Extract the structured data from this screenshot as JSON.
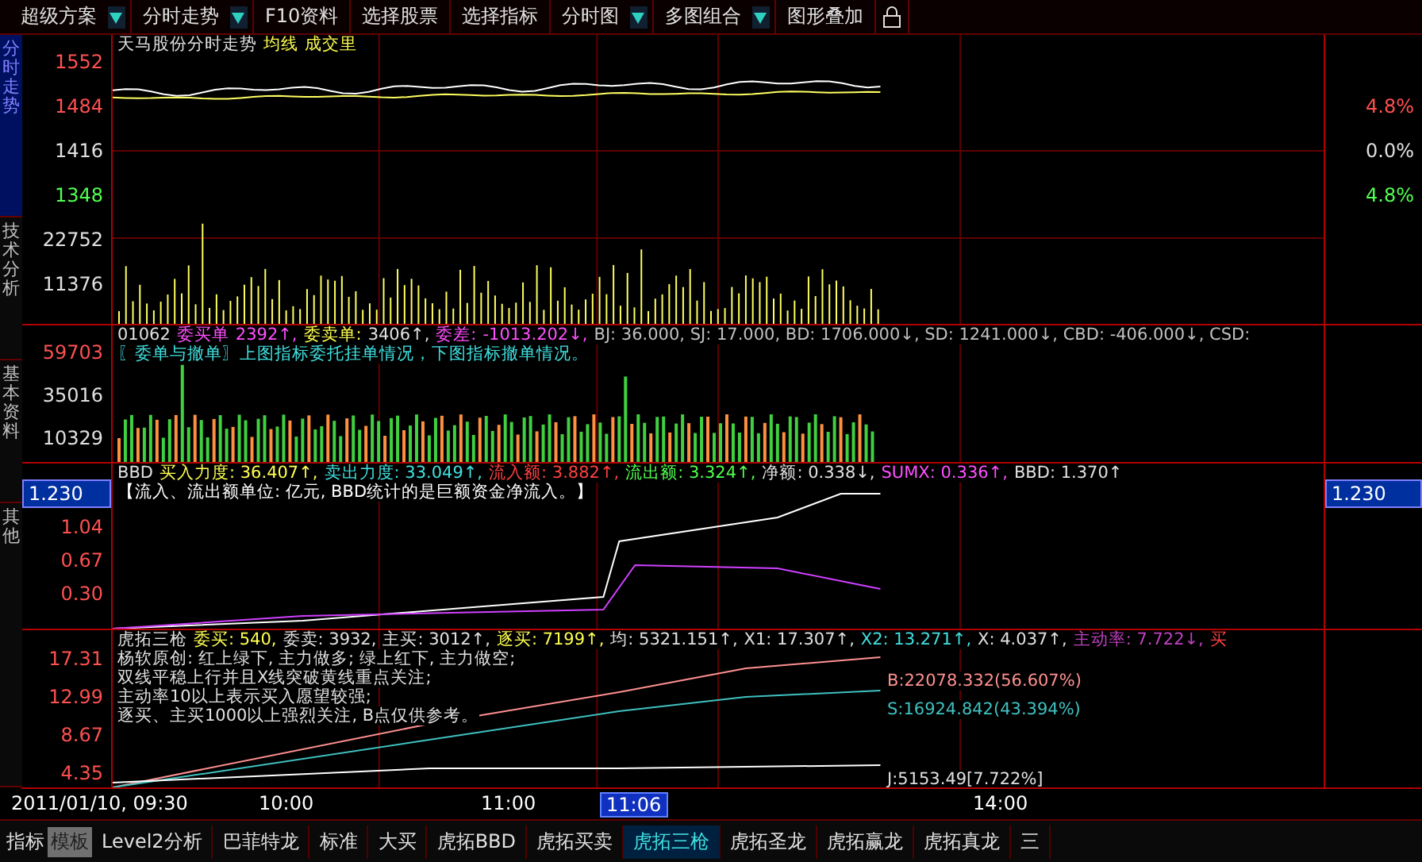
{
  "toolbar": [
    {
      "label": "超级方案",
      "dropdown": true
    },
    {
      "label": "分时走势",
      "dropdown": true
    },
    {
      "label": "F10资料",
      "dropdown": false
    },
    {
      "label": "选择股票",
      "dropdown": false
    },
    {
      "label": "选择指标",
      "dropdown": false
    },
    {
      "label": "分时图",
      "dropdown": true
    },
    {
      "label": "多图组合",
      "dropdown": true
    },
    {
      "label": "图形叠加",
      "dropdown": false
    }
  ],
  "side_tabs": [
    {
      "label": "分时走势",
      "selected": true
    },
    {
      "label": "技术分析",
      "selected": false
    },
    {
      "label": "基本资料",
      "selected": false
    },
    {
      "label": "其他",
      "selected": false
    }
  ],
  "panels": [
    {
      "kind": "price",
      "header": [
        [
          {
            "text": "天马股份分时走势",
            "color": "#e0e0e0"
          },
          {
            "text": "均线",
            "color": "#ffff50"
          },
          {
            "text": "成交里",
            "color": "#ffff50"
          }
        ]
      ],
      "left_axis": [
        {
          "text": "1552",
          "color": "#ff5050"
        },
        {
          "text": "1484",
          "color": "#ff5050"
        },
        {
          "text": "1416",
          "color": "#e0e0e0"
        },
        {
          "text": "1348",
          "color": "#50ff50"
        },
        {
          "text": "22752",
          "color": "#e0e0e0"
        },
        {
          "text": "11376",
          "color": "#e0e0e0"
        }
      ],
      "right_axis": [
        {
          "text": "4.8%",
          "color": "#ff5050"
        },
        {
          "text": "0.0%",
          "color": "#e0e0e0"
        },
        {
          "text": "4.8%",
          "color": "#50ff50"
        }
      ]
    },
    {
      "kind": "orders",
      "header": [
        [
          {
            "text": "01062",
            "color": "#e0e0e0"
          },
          {
            "text": "委买单",
            "color": "#ff50ff"
          },
          {
            "text": "2392↑,",
            "color": "#ff50ff"
          },
          {
            "text": "委卖单:",
            "color": "#ffff50"
          },
          {
            "text": "3406↑,",
            "color": "#e0e0e0"
          },
          {
            "text": "委差:",
            "color": "#ff50ff"
          },
          {
            "text": "-1013.202↓,",
            "color": "#ff50ff"
          },
          {
            "text": "BJ: 36.000, SJ: 17.000, BD: 1706.000↓, SD: 1241.000↓, CBD: -406.000↓, CSD:",
            "color": "#c0c0c0"
          }
        ],
        [
          {
            "text": "〖委单与撤单〗上图指标委托挂单情况，下图指标撤单情况。",
            "color": "#40e0e0"
          }
        ]
      ],
      "left_axis": [
        {
          "text": "59703",
          "color": "#ff5050"
        },
        {
          "text": "35016",
          "color": "#e0e0e0"
        },
        {
          "text": "10329",
          "color": "#e0e0e0"
        }
      ]
    },
    {
      "kind": "flow",
      "header": [
        [
          {
            "text": "BBD",
            "color": "#e0e0e0"
          },
          {
            "text": "买入力度: 36.407↑,",
            "color": "#ffff50"
          },
          {
            "text": "卖出力度: 33.049↑,",
            "color": "#40e0e0"
          },
          {
            "text": "流入额: 3.882↑,",
            "color": "#ff4040"
          },
          {
            "text": "流出额: 3.324↑,",
            "color": "#50ff50"
          },
          {
            "text": "净额: 0.338↓,",
            "color": "#e0e0e0"
          },
          {
            "text": "SUMX: 0.336↑,",
            "color": "#ff50ff"
          },
          {
            "text": "BBD: 1.370↑",
            "color": "#e0e0e0"
          }
        ],
        [
          {
            "text": "【流入、流出额单位: 亿元, BBD统计的是巨额资金净流入。】",
            "color": "#ffffff"
          }
        ]
      ],
      "left_axis": [
        {
          "text": "1.230",
          "boxed": true
        },
        {
          "text": "1.04",
          "color": "#ff5050",
          "boxed": false
        },
        {
          "text": "0.67",
          "color": "#ff5050",
          "boxed": false
        },
        {
          "text": "0.30",
          "color": "#ff5050",
          "boxed": false
        }
      ],
      "right_axis": [
        {
          "text": "1.230",
          "boxed": true
        }
      ]
    },
    {
      "kind": "guns",
      "header": [
        [
          {
            "text": "虎拓三枪",
            "color": "#e0e0e0"
          },
          {
            "text": "委买: 540,",
            "color": "#ffff50"
          },
          {
            "text": "委卖: 3932,",
            "color": "#e0e0e0"
          },
          {
            "text": "主买: 3012↑,",
            "color": "#e0e0e0"
          },
          {
            "text": "逐买: 7199↑,",
            "color": "#ffff50"
          },
          {
            "text": "均: 5321.151↑,",
            "color": "#e0e0e0"
          },
          {
            "text": "X1: 17.307↑,",
            "color": "#e0e0e0"
          },
          {
            "text": "X2: 13.271↑,",
            "color": "#40e0e0"
          },
          {
            "text": "X: 4.037↑,",
            "color": "#e0e0e0"
          },
          {
            "text": "主动率: 7.722↓,",
            "color": "#c040c0"
          },
          {
            "text": "买",
            "color": "#ff4040"
          }
        ],
        [
          {
            "text": "杨软原创: 红上绿下, 主力做多; 绿上红下, 主力做空;",
            "color": "#e0e0e0"
          }
        ],
        [
          {
            "text": "双线平稳上行并且X线突破黄线重点关注;",
            "color": "#e0e0e0"
          }
        ],
        [
          {
            "text": "主动率10以上表示买入愿望较强;",
            "color": "#e0e0e0"
          }
        ],
        [
          {
            "text": "逐买、主买1000以上强烈关注, B点仅供参考。",
            "color": "#e0e0e0"
          }
        ]
      ],
      "left_axis": [
        {
          "text": "17.31",
          "color": "#ff5050"
        },
        {
          "text": "12.99",
          "color": "#ff5050"
        },
        {
          "text": "8.67",
          "color": "#ff5050"
        },
        {
          "text": "4.35",
          "color": "#ff5050"
        }
      ],
      "chart_labels": [
        {
          "text": "B:22078.332(56.607%)",
          "color": "#ff9090"
        },
        {
          "text": "S:16924.842(43.394%)",
          "color": "#40c0c0"
        },
        {
          "text": "J:5153.49[7.722%]",
          "color": "#e0e0e0"
        }
      ]
    }
  ],
  "time_axis": [
    {
      "text": "2011/01/10, 09:30",
      "selected": false
    },
    {
      "text": "10:00",
      "selected": false
    },
    {
      "text": "11:00",
      "selected": false
    },
    {
      "text": "11:06",
      "selected": true
    },
    {
      "text": "14:00",
      "selected": false
    }
  ],
  "mode_tabs": [
    {
      "label": "指标",
      "selected": false
    },
    {
      "label": "模板",
      "selected": true
    }
  ],
  "bottom_tabs": [
    {
      "label": "Level2分析",
      "selected": false
    },
    {
      "label": "巴菲特龙",
      "selected": false
    },
    {
      "label": "标准",
      "selected": false
    },
    {
      "label": "大买",
      "selected": false
    },
    {
      "label": "虎拓BBD",
      "selected": false
    },
    {
      "label": "虎拓买卖",
      "selected": false
    },
    {
      "label": "虎拓三枪",
      "selected": true
    },
    {
      "label": "虎拓圣龙",
      "selected": false
    },
    {
      "label": "虎拓赢龙",
      "selected": false
    },
    {
      "label": "虎拓真龙",
      "selected": false
    },
    {
      "label": "三",
      "selected": false
    }
  ]
}
